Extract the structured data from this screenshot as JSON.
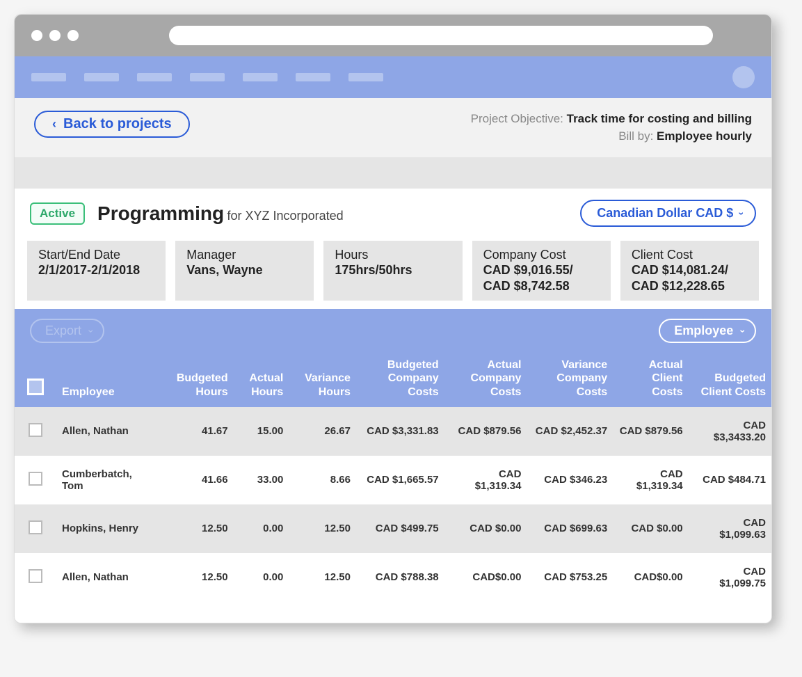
{
  "header": {
    "back_label": "Back to projects",
    "objective_label": "Project Objective: ",
    "objective_value": "Track time for costing and billing",
    "bill_by_label": "Bill by: ",
    "bill_by_value": "Employee hourly"
  },
  "project": {
    "status": "Active",
    "title": "Programming",
    "client_prefix": "for ",
    "client": "XYZ Incorporated",
    "currency_label": "Canadian Dollar CAD $"
  },
  "info": {
    "date_label": "Start/End Date",
    "date_value": "2/1/2017-2/1/2018",
    "manager_label": "Manager",
    "manager_value": "Vans, Wayne",
    "hours_label": "Hours",
    "hours_value": "175hrs/50hrs",
    "company_cost_label": "Company Cost",
    "company_cost_value": "CAD $9,016.55/ CAD $8,742.58",
    "client_cost_label": "Client Cost",
    "client_cost_value": "CAD $14,081.24/ CAD $12,228.65"
  },
  "controls": {
    "export_label": "Export",
    "view_label": "Employee"
  },
  "columns": {
    "employee": "Employee",
    "budgeted_hours": "Budgeted Hours",
    "actual_hours": "Actual Hours",
    "variance_hours": "Variance Hours",
    "budgeted_company": "Budgeted Company Costs",
    "actual_company": "Actual Company Costs",
    "variance_company": "Variance Company Costs",
    "actual_client": "Actual Client Costs",
    "budgeted_client": "Budgeted Client Costs"
  },
  "rows": [
    {
      "name": "Allen, Nathan",
      "budgeted_hours": "41.67",
      "actual_hours": "15.00",
      "variance_hours": "26.67",
      "budgeted_company": "CAD $3,331.83",
      "actual_company": "CAD $879.56",
      "variance_company": "CAD $2,452.37",
      "actual_client": "CAD $879.56",
      "budgeted_client": "CAD $3,3433.20"
    },
    {
      "name": "Cumberbatch, Tom",
      "budgeted_hours": "41.66",
      "actual_hours": "33.00",
      "variance_hours": "8.66",
      "budgeted_company": "CAD $1,665.57",
      "actual_company": "CAD $1,319.34",
      "variance_company": "CAD $346.23",
      "actual_client": "CAD $1,319.34",
      "budgeted_client": "CAD $484.71"
    },
    {
      "name": "Hopkins, Henry",
      "budgeted_hours": "12.50",
      "actual_hours": "0.00",
      "variance_hours": "12.50",
      "budgeted_company": "CAD $499.75",
      "actual_company": "CAD $0.00",
      "variance_company": "CAD $699.63",
      "actual_client": "CAD $0.00",
      "budgeted_client": "CAD $1,099.63"
    },
    {
      "name": "Allen, Nathan",
      "budgeted_hours": "12.50",
      "actual_hours": "0.00",
      "variance_hours": "12.50",
      "budgeted_company": "CAD $788.38",
      "actual_company": "CAD$0.00",
      "variance_company": "CAD $753.25",
      "actual_client": "CAD$0.00",
      "budgeted_client": "CAD $1,099.75"
    }
  ]
}
